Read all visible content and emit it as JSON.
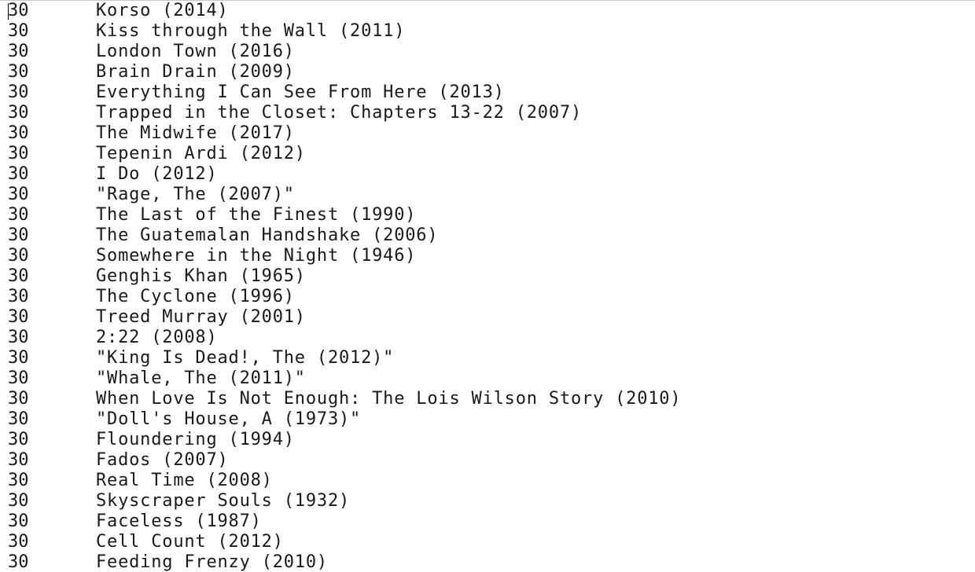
{
  "rows": [
    {
      "count": "30",
      "title": "Korso (2014)"
    },
    {
      "count": "30",
      "title": "Kiss through the Wall (2011)"
    },
    {
      "count": "30",
      "title": "London Town (2016)"
    },
    {
      "count": "30",
      "title": "Brain Drain (2009)"
    },
    {
      "count": "30",
      "title": "Everything I Can See From Here (2013)"
    },
    {
      "count": "30",
      "title": "Trapped in the Closet: Chapters 13-22 (2007)"
    },
    {
      "count": "30",
      "title": "The Midwife (2017)"
    },
    {
      "count": "30",
      "title": "Tepenin Ardi (2012)"
    },
    {
      "count": "30",
      "title": "I Do (2012)"
    },
    {
      "count": "30",
      "title": "\"Rage, The (2007)\""
    },
    {
      "count": "30",
      "title": "The Last of the Finest (1990)"
    },
    {
      "count": "30",
      "title": "The Guatemalan Handshake (2006)"
    },
    {
      "count": "30",
      "title": "Somewhere in the Night (1946)"
    },
    {
      "count": "30",
      "title": "Genghis Khan (1965)"
    },
    {
      "count": "30",
      "title": "The Cyclone (1996)"
    },
    {
      "count": "30",
      "title": "Treed Murray (2001)"
    },
    {
      "count": "30",
      "title": "2:22 (2008)"
    },
    {
      "count": "30",
      "title": "\"King Is Dead!, The (2012)\""
    },
    {
      "count": "30",
      "title": "\"Whale, The (2011)\""
    },
    {
      "count": "30",
      "title": "When Love Is Not Enough: The Lois Wilson Story (2010)"
    },
    {
      "count": "30",
      "title": "\"Doll's House, A (1973)\""
    },
    {
      "count": "30",
      "title": "Floundering (1994)"
    },
    {
      "count": "30",
      "title": "Fados (2007)"
    },
    {
      "count": "30",
      "title": "Real Time (2008)"
    },
    {
      "count": "30",
      "title": "Skyscraper Souls (1932)"
    },
    {
      "count": "30",
      "title": "Faceless (1987)"
    },
    {
      "count": "30",
      "title": "Cell Count (2012)"
    },
    {
      "count": "30",
      "title": "Feeding Frenzy (2010)"
    }
  ]
}
